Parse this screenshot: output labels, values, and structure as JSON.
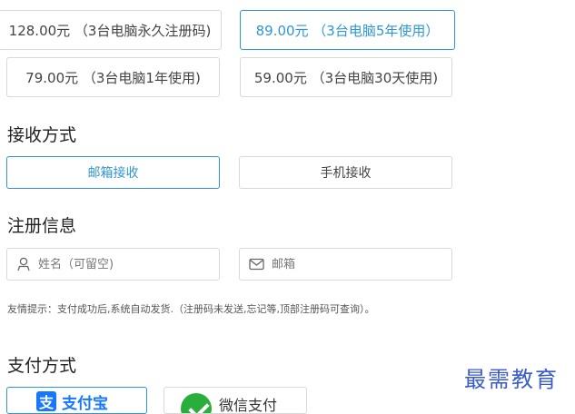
{
  "plans": [
    {
      "label": "128.00元 （3台电脑永久注册码)"
    },
    {
      "label": "89.00元 （3台电脑5年使用）",
      "selected": true
    },
    {
      "label": "79.00元 （3台电脑1年使用)"
    },
    {
      "label": "59.00元 （3台电脑30天使用)"
    }
  ],
  "delivery": {
    "title": "接收方式",
    "options": [
      {
        "label": "邮箱接收",
        "selected": true
      },
      {
        "label": "手机接收"
      }
    ]
  },
  "registration": {
    "title": "注册信息",
    "name_placeholder": "姓名（可留空)",
    "email_placeholder": "邮箱"
  },
  "hint": "友情提示：支付成功后,系统自动发货.（注册码未发送,忘记等,顶部注册码可查询）。",
  "payment": {
    "title": "支付方式",
    "alipay_logo_char": "支",
    "alipay_label": "支付宝",
    "wechat_label": "微信支付"
  },
  "watermark": "最需教育",
  "colors": {
    "accent": "#2f97d3",
    "alipay": "#1677ff",
    "wechat": "#2aae3b",
    "border": "#d9d9d9"
  },
  "icons": {
    "name_field": "user-icon",
    "email_field": "mail-icon"
  }
}
